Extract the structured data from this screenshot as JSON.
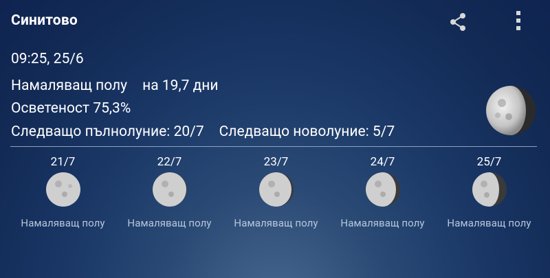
{
  "app": {
    "title": "Синитово",
    "share_icon": "share-icon",
    "menu_icon": "more-vert-icon"
  },
  "current": {
    "datetime": "09:25, 25/6",
    "phase_label": "Намаляващ полу",
    "phase_age": "на 19,7 дни",
    "illumination": "Осветеност 75,3%",
    "next_full": "Следващо пълнолуние: 20/7",
    "next_new": "Следващо новолуние: 5/7"
  },
  "forecast": [
    {
      "date": "21/7",
      "phase": "Намаляващ полу"
    },
    {
      "date": "22/7",
      "phase": "Намаляващ полу"
    },
    {
      "date": "23/7",
      "phase": "Намаляващ полу"
    },
    {
      "date": "24/7",
      "phase": "Намаляващ полу"
    },
    {
      "date": "25/7",
      "phase": "Намаляващ полу"
    }
  ]
}
